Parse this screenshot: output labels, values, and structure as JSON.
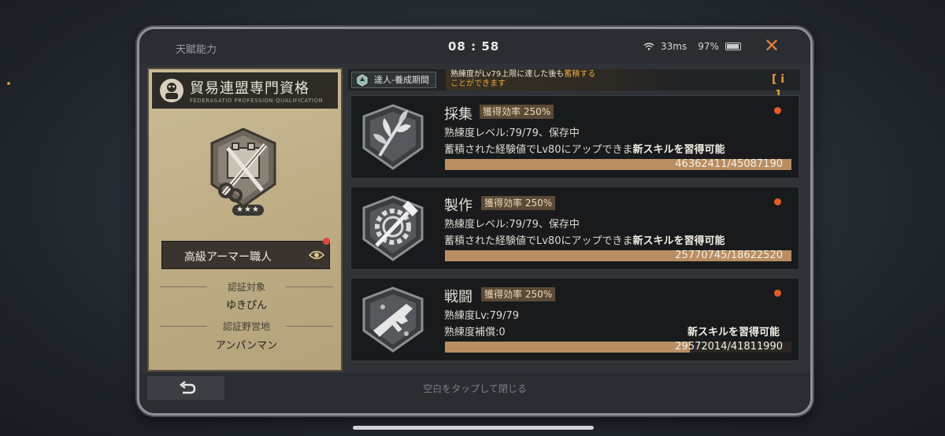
{
  "topbar": {
    "title": "天賦能力",
    "time": "08 : 58",
    "ping": "33ms",
    "battery": "97%",
    "close_icon": "close-icon"
  },
  "certificate": {
    "title": "貿易連盟専門資格",
    "subtitle": "FEDERASATIO PROFESSION QUALIFICATION",
    "stars": 3,
    "rank_label": "高級アーマー職人",
    "target_label": "認証対象",
    "target_value": "ゆきぴん",
    "camp_label": "認証野営地",
    "camp_value": "アンパンマン"
  },
  "infobar": {
    "tag": "達人-養成期間",
    "msg_part1": "熟練度がLv79上限に達した後も",
    "msg_highlight": "蓄積する",
    "msg_part2": "ことができます",
    "info_label": "[ i ]"
  },
  "skills": [
    {
      "name": "採集",
      "rate": "獲得効率 250%",
      "line1": "熟練度レベル:79/79、保存中",
      "line2_prefix": "蓄積された経験値でLv80にアップできま",
      "line2_new": "新スキルを習得可能",
      "progress_text": "46362411/45087190",
      "progress": 1.0,
      "icon": "herb-shield-icon"
    },
    {
      "name": "製作",
      "rate": "獲得効率 250%",
      "line1": "熟練度レベル:79/79、保存中",
      "line2_prefix": "蓄積された経験値でLv80にアップできま",
      "line2_new": "新スキルを習得可能",
      "progress_text": "25770745/18622520",
      "progress": 1.0,
      "icon": "gear-hammer-shield-icon"
    },
    {
      "name": "戦闘",
      "rate": "獲得効率 250%",
      "line1": "熟練度Lv:79/79",
      "line2_prefix": "熟練度補償:0",
      "line2_new": "新スキルを習得可能",
      "progress_text": "29572014/41811990",
      "progress": 0.707,
      "icon": "gun-shield-icon"
    }
  ],
  "bottom": {
    "hint": "空白をタップして閉じる"
  },
  "colors": {
    "accent": "#e3803a",
    "progress": "#b88e62",
    "highlight": "#e5a53d",
    "notify": "#e25a2a"
  }
}
